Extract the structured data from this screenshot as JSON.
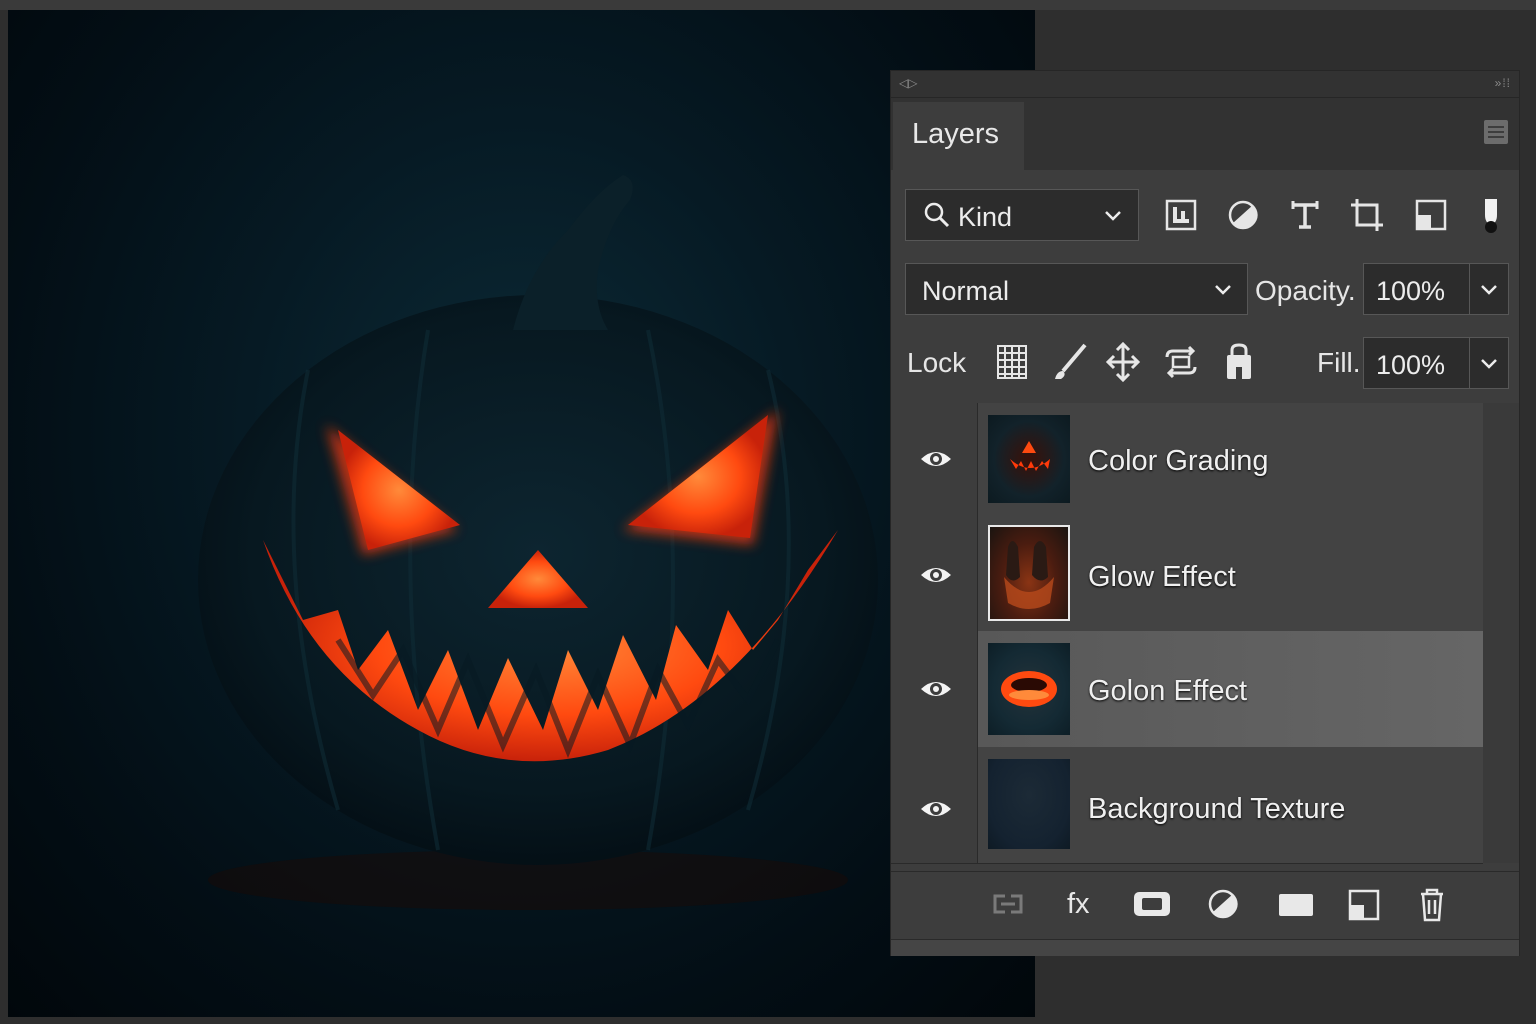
{
  "panel": {
    "title": "Layers",
    "collapse_icon": "expand-arrows-icon",
    "menu_icon": "panel-menu-icon"
  },
  "filter": {
    "kind_label": "Kind",
    "icons": [
      "pixel-layer-filter-icon",
      "adjustment-layer-filter-icon",
      "type-layer-filter-icon",
      "shape-layer-filter-icon",
      "smart-object-filter-icon",
      "filter-toggle-icon"
    ]
  },
  "blend": {
    "mode": "Normal",
    "opacity_label": "Opacity.",
    "opacity_value": "100%"
  },
  "lock": {
    "label": "Lock",
    "icons": [
      "lock-transparent-pixels-icon",
      "lock-image-pixels-icon",
      "lock-position-icon",
      "lock-artboard-icon",
      "lock-all-icon"
    ],
    "fill_label": "Fill.",
    "fill_value": "100%"
  },
  "layers": [
    {
      "name": "Color Grading",
      "visible": true,
      "selected": false
    },
    {
      "name": "Glow Effect",
      "visible": true,
      "selected": false
    },
    {
      "name": "Golon Effect",
      "visible": true,
      "selected": true
    },
    {
      "name": "Background Texture",
      "visible": true,
      "selected": false
    }
  ],
  "footer": {
    "fx_label": "fx",
    "icons": [
      "link-layers-icon",
      "layer-style-icon",
      "layer-mask-icon",
      "adjustment-layer-icon",
      "group-icon",
      "new-layer-icon",
      "delete-layer-icon"
    ]
  },
  "colors": {
    "panel_bg": "#3d3d3d",
    "selected_row": "#5f5f5f",
    "glow_orange": "#ff5a14"
  }
}
